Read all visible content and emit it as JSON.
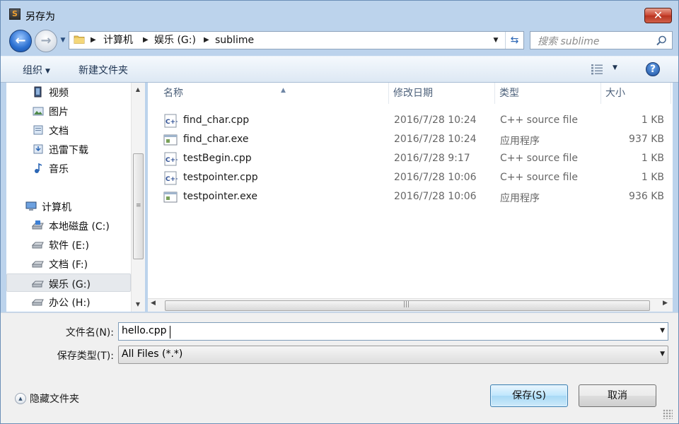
{
  "window": {
    "title": "另存为",
    "close_label": "✕"
  },
  "nav": {
    "back_label": "←",
    "forward_label": "→",
    "breadcrumbs": [
      "计算机",
      "娱乐 (G:)",
      "sublime"
    ],
    "search_placeholder": "搜索 sublime"
  },
  "toolbar": {
    "organize_label": "组织",
    "new_folder_label": "新建文件夹",
    "help_label": "?"
  },
  "sidebar": {
    "items": [
      {
        "label": "视频",
        "icon": "video-library-icon",
        "level": 1
      },
      {
        "label": "图片",
        "icon": "pictures-library-icon",
        "level": 1
      },
      {
        "label": "文档",
        "icon": "documents-library-icon",
        "level": 1
      },
      {
        "label": "迅雷下载",
        "icon": "download-library-icon",
        "level": 1
      },
      {
        "label": "音乐",
        "icon": "music-library-icon",
        "level": 1
      },
      {
        "label": "计算机",
        "icon": "computer-icon",
        "level": 0
      },
      {
        "label": "本地磁盘 (C:)",
        "icon": "system-drive-icon",
        "level": 1
      },
      {
        "label": "软件 (E:)",
        "icon": "drive-icon",
        "level": 1
      },
      {
        "label": "文档 (F:)",
        "icon": "drive-icon",
        "level": 1
      },
      {
        "label": "娱乐 (G:)",
        "icon": "drive-icon",
        "level": 1,
        "selected": true
      },
      {
        "label": "办公 (H:)",
        "icon": "drive-icon",
        "level": 1
      }
    ]
  },
  "files": {
    "columns": [
      "名称",
      "修改日期",
      "类型",
      "大小"
    ],
    "rows": [
      {
        "name": "find_char.cpp",
        "date": "2016/7/28 10:24",
        "type": "C++ source file",
        "size": "1 KB",
        "icon": "cpp-file-icon"
      },
      {
        "name": "find_char.exe",
        "date": "2016/7/28 10:24",
        "type": "应用程序",
        "size": "937 KB",
        "icon": "exe-file-icon"
      },
      {
        "name": "testBegin.cpp",
        "date": "2016/7/28 9:17",
        "type": "C++ source file",
        "size": "1 KB",
        "icon": "cpp-file-icon"
      },
      {
        "name": "testpointer.cpp",
        "date": "2016/7/28 10:06",
        "type": "C++ source file",
        "size": "1 KB",
        "icon": "cpp-file-icon"
      },
      {
        "name": "testpointer.exe",
        "date": "2016/7/28 10:06",
        "type": "应用程序",
        "size": "936 KB",
        "icon": "exe-file-icon"
      }
    ]
  },
  "form": {
    "filename_label": "文件名(N):",
    "filename_value": "hello.cpp",
    "filetype_label": "保存类型(T):",
    "filetype_value": "All Files (*.*)"
  },
  "footer": {
    "hide_folders_label": "隐藏文件夹",
    "save_label": "保存(S)",
    "cancel_label": "取消"
  }
}
